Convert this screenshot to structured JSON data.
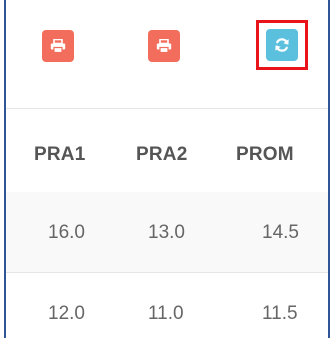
{
  "toolbar": {
    "buttons": [
      {
        "icon": "print-icon",
        "color": "#f26d5b"
      },
      {
        "icon": "print-icon",
        "color": "#f26d5b"
      },
      {
        "icon": "refresh-icon",
        "color": "#5bc0de",
        "highlighted": true,
        "highlight_color": "#e8141a"
      }
    ]
  },
  "table": {
    "columns": [
      "PRA1",
      "PRA2",
      "PROM"
    ],
    "rows": [
      [
        "16.0",
        "13.0",
        "14.5"
      ],
      [
        "12.0",
        "11.0",
        "11.5"
      ]
    ]
  }
}
